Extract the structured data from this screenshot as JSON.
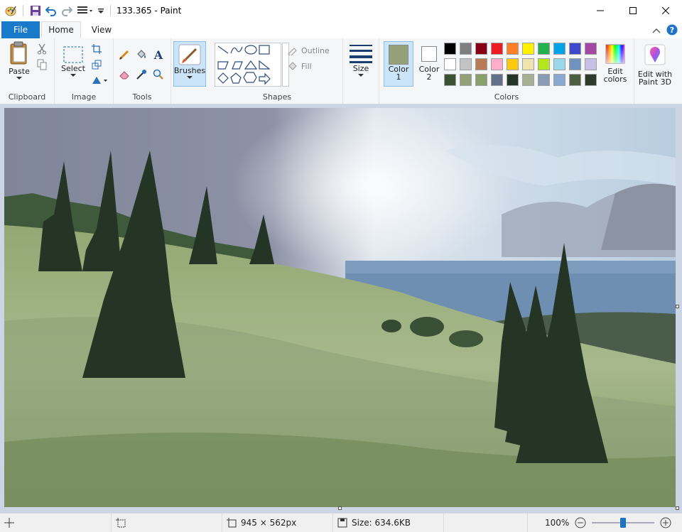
{
  "window": {
    "title": "133.365 - Paint"
  },
  "tabs": {
    "file": "File",
    "home": "Home",
    "view": "View"
  },
  "ribbon": {
    "clipboard": {
      "label": "Clipboard",
      "paste": "Paste"
    },
    "image": {
      "label": "Image",
      "select": "Select"
    },
    "tools": {
      "label": "Tools"
    },
    "brushes": {
      "label": "Brushes"
    },
    "shapes": {
      "label": "Shapes",
      "outline": "Outline",
      "fill": "Fill"
    },
    "size": {
      "label": "Size"
    },
    "colors": {
      "label": "Colors",
      "color1_line1": "Color",
      "color1_line2": "1",
      "color2_line1": "Color",
      "color2_line2": "2",
      "color1_value": "#94a178",
      "color2_value": "#ffffff",
      "edit_line1": "Edit",
      "edit_line2": "colors",
      "palette": [
        "#000000",
        "#7f7f7f",
        "#880015",
        "#ed1c24",
        "#ff7f27",
        "#fff200",
        "#22b14c",
        "#00a2e8",
        "#3f48cc",
        "#a349a4",
        "#ffffff",
        "#c3c3c3",
        "#b97a57",
        "#ffaec9",
        "#ffc90e",
        "#efe4b0",
        "#b5e61d",
        "#99d9ea",
        "#7092be",
        "#c8bfe7",
        "#3a5233",
        "#94a178",
        "#8aa06a",
        "#62708a",
        "#26352a",
        "#a7b093",
        "#8a9bb5",
        "#8aa9d0",
        "#4d5e42",
        "#2c3a2c"
      ]
    },
    "paint3d": {
      "line1": "Edit with",
      "line2": "Paint 3D"
    }
  },
  "status": {
    "dimensions": "945 × 562px",
    "size": "Size: 634.6KB",
    "zoom": "100%",
    "zoom_level_fraction": 0.5
  }
}
